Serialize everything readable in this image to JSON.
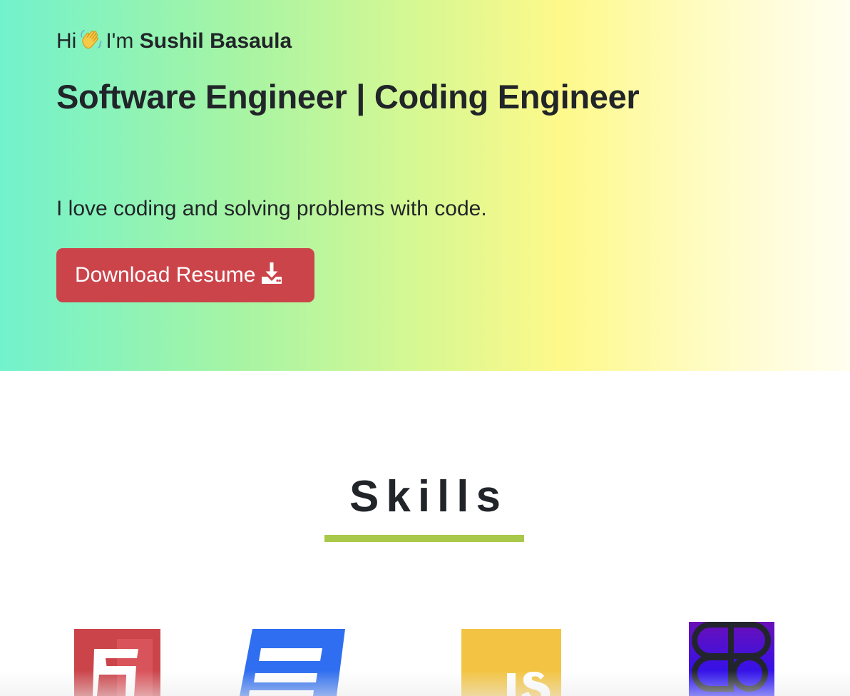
{
  "hero": {
    "greeting_prefix": "Hi",
    "greeting_im": "I'm",
    "name": "Sushil Basaula",
    "title": "Software Engineer | Coding Engineer",
    "tagline": "I love coding and solving problems with code.",
    "download_button_label": "Download Resume",
    "wave_icon": "waving-hand-icon",
    "download_icon": "download-icon",
    "colors": {
      "gradient_start": "#72f2cc",
      "gradient_mid": "#fef98a",
      "gradient_end": "#fffef0",
      "button": "#cb444a"
    }
  },
  "skills": {
    "heading": "Skills",
    "underline_color": "#a8c84a",
    "logos": [
      {
        "name": "html5-logo",
        "text": "5",
        "color": "#cb444a"
      },
      {
        "name": "css3-logo",
        "color": "#2f6ef0"
      },
      {
        "name": "javascript-logo",
        "text": "JS",
        "color": "#f3c443"
      },
      {
        "name": "figma-logo",
        "color": "#2a10e0"
      }
    ]
  }
}
